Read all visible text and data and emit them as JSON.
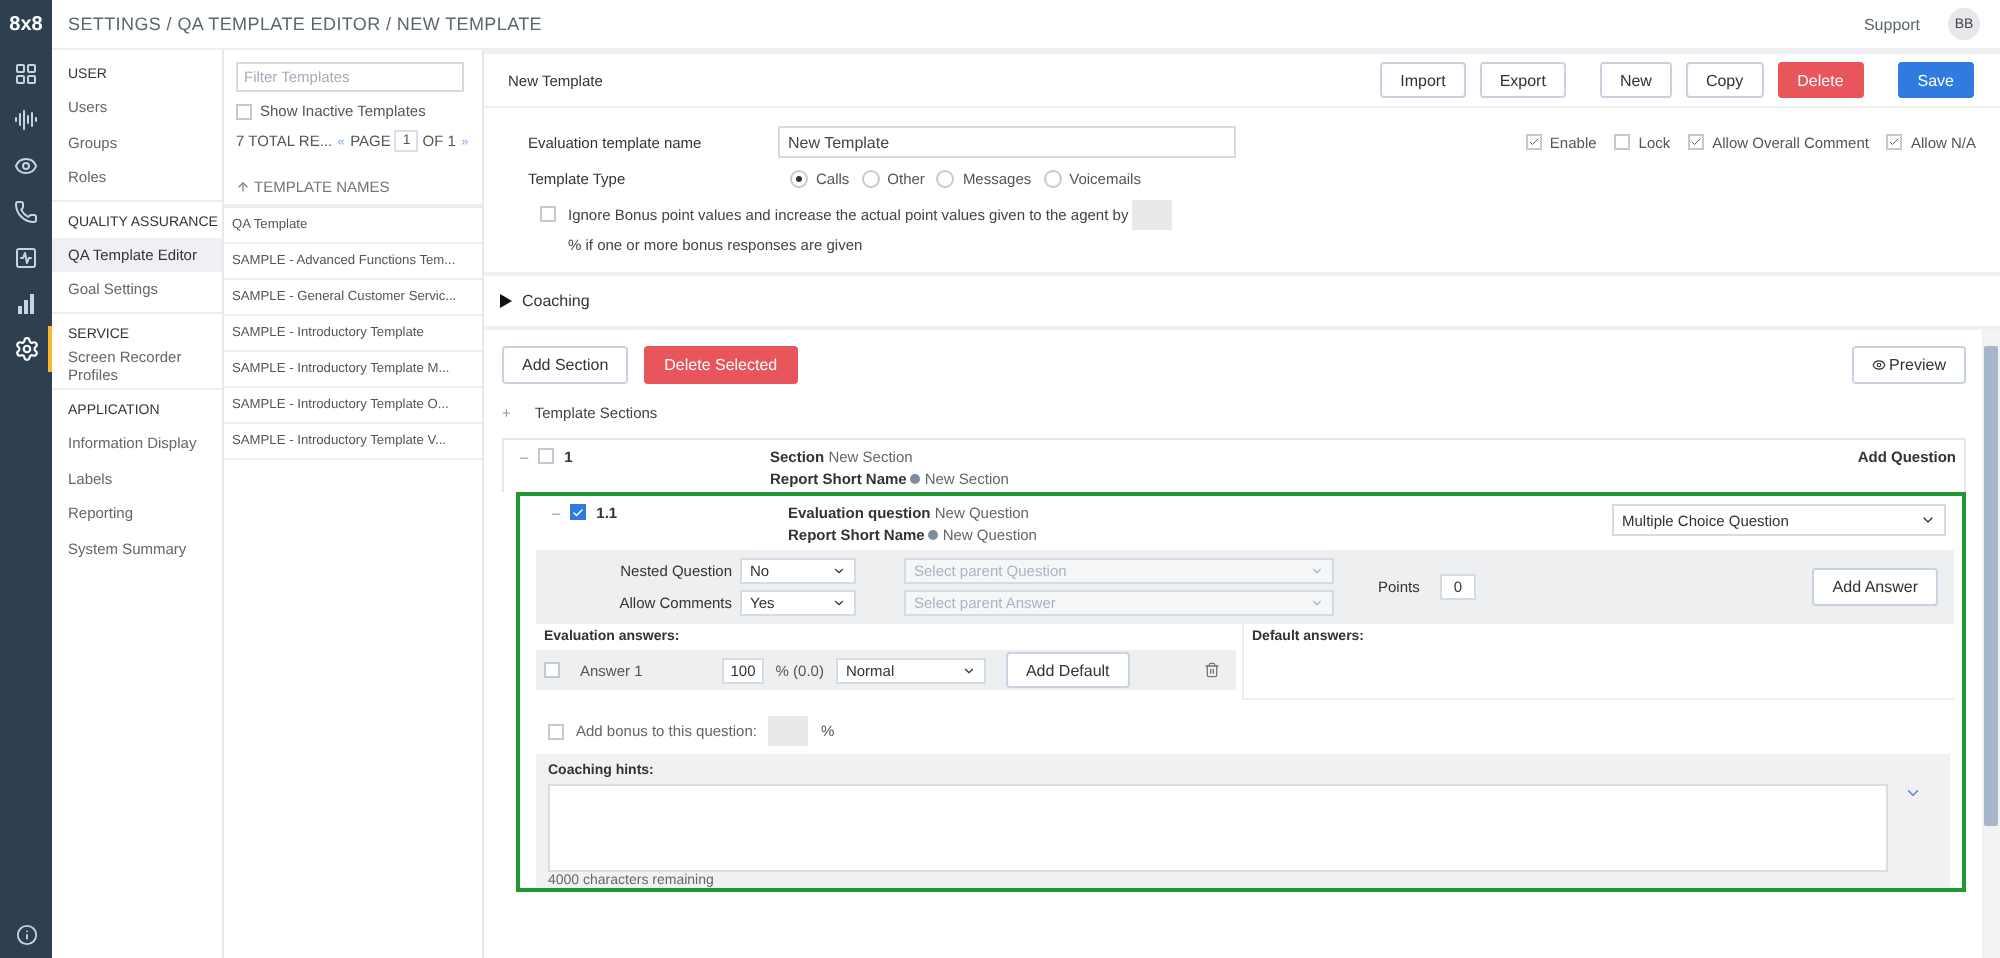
{
  "app": {
    "logo": "8x8",
    "breadcrumb": "SETTINGS / QA TEMPLATE EDITOR / NEW TEMPLATE",
    "support": "Support",
    "avatar": "BB"
  },
  "rail": [
    {
      "kind": "grid",
      "selected": false
    },
    {
      "kind": "audio",
      "selected": false
    },
    {
      "kind": "eye",
      "selected": false
    },
    {
      "kind": "phone",
      "selected": false
    },
    {
      "kind": "monitor",
      "selected": false
    },
    {
      "kind": "chart",
      "selected": false
    },
    {
      "kind": "gear",
      "selected": true
    }
  ],
  "settings_nav": [
    {
      "heading": "USER",
      "items": [
        {
          "label": "Users",
          "selected": false
        },
        {
          "label": "Groups",
          "selected": false
        },
        {
          "label": "Roles",
          "selected": false
        }
      ]
    },
    {
      "heading": "QUALITY ASSURANCE",
      "items": [
        {
          "label": "QA Template Editor",
          "selected": true
        },
        {
          "label": "Goal Settings",
          "selected": false
        }
      ]
    },
    {
      "heading": "SERVICE",
      "items": [
        {
          "label": "Screen Recorder Profiles",
          "selected": false
        }
      ]
    },
    {
      "heading": "APPLICATION",
      "items": [
        {
          "label": "Information Display",
          "selected": false
        },
        {
          "label": "Labels",
          "selected": false
        },
        {
          "label": "Reporting",
          "selected": false
        },
        {
          "label": "System Summary",
          "selected": false
        }
      ]
    }
  ],
  "templates": {
    "filter_placeholder": "Filter Templates",
    "show_inactive": {
      "label": "Show Inactive Templates",
      "checked": false
    },
    "total": "7 TOTAL RE...",
    "page_label": "PAGE",
    "page": "1",
    "of": "OF 1",
    "column": "TEMPLATE NAMES",
    "rows": [
      {
        "name": "QA Template"
      },
      {
        "name": "SAMPLE - Advanced Functions Tem..."
      },
      {
        "name": "SAMPLE - General Customer Servic..."
      },
      {
        "name": "SAMPLE - Introductory Template"
      },
      {
        "name": "SAMPLE - Introductory Template M..."
      },
      {
        "name": "SAMPLE - Introductory Template O..."
      },
      {
        "name": "SAMPLE - Introductory Template V..."
      }
    ]
  },
  "editor": {
    "title": "New Template",
    "button_groups": [
      [
        {
          "label": "Import",
          "kind": "default"
        },
        {
          "label": "Export",
          "kind": "default"
        }
      ],
      [
        {
          "label": "New",
          "kind": "default"
        },
        {
          "label": "Copy",
          "kind": "default"
        },
        {
          "label": "Delete",
          "kind": "danger"
        }
      ],
      [
        {
          "label": "Save",
          "kind": "primary"
        }
      ]
    ],
    "name_label": "Evaluation template name",
    "name_value": "New Template",
    "flags": [
      {
        "label": "Enable",
        "checked": true
      },
      {
        "label": "Lock",
        "checked": false
      },
      {
        "label": "Allow Overall Comment",
        "checked": true
      },
      {
        "label": "Allow N/A",
        "checked": true
      }
    ],
    "type_label": "Template Type",
    "types": [
      {
        "label": "Calls",
        "selected": true
      },
      {
        "label": "Other",
        "selected": false
      },
      {
        "label": "Messages",
        "selected": false
      },
      {
        "label": "Voicemails",
        "selected": false
      }
    ],
    "bonus": {
      "checked": false,
      "text_before": "Ignore Bonus point values and increase the actual point values given to the agent by",
      "text_after": "% if one or more bonus responses are given"
    },
    "coaching": {
      "label": "Coaching",
      "expanded": false
    }
  },
  "sections": {
    "buttons": [
      {
        "label": "Add Section",
        "kind": "default"
      },
      {
        "label": "Delete Selected",
        "kind": "danger"
      }
    ],
    "preview": "Preview",
    "tree_toggle": "+",
    "tree_label": "Template Sections",
    "section": {
      "toggle": "–",
      "checked": false,
      "number": "1",
      "section_label": "Section",
      "section_value": "New Section",
      "short_label": "Report Short Name",
      "short_value": "New Section",
      "add_question": "Add Question"
    },
    "question": {
      "highlighted": true,
      "toggle": "–",
      "checked": true,
      "number": "1.1",
      "question_label": "Evaluation question",
      "question_value": "New Question",
      "short_label": "Report Short Name",
      "short_value": "New Question",
      "type": "Multiple Choice Question",
      "nested_label": "Nested Question",
      "nested_value": "No",
      "comments_label": "Allow Comments",
      "comments_value": "Yes",
      "parent_question_placeholder": "Select parent Question",
      "parent_answer_placeholder": "Select parent Answer",
      "points_label": "Points",
      "points_value": "0",
      "add_answer": "Add Answer",
      "answers_label": "Evaluation answers:",
      "default_label": "Default answers:",
      "answers": [
        {
          "checked": false,
          "label": "Answer 1",
          "percent": "100",
          "suffix": "% (0.0)",
          "type": "Normal",
          "button": "Add Default"
        }
      ],
      "bonus": {
        "checked": false,
        "label": "Add bonus to this question:",
        "suffix": "%"
      },
      "hints_label": "Coaching hints:",
      "remaining": "4000 characters remaining"
    }
  }
}
